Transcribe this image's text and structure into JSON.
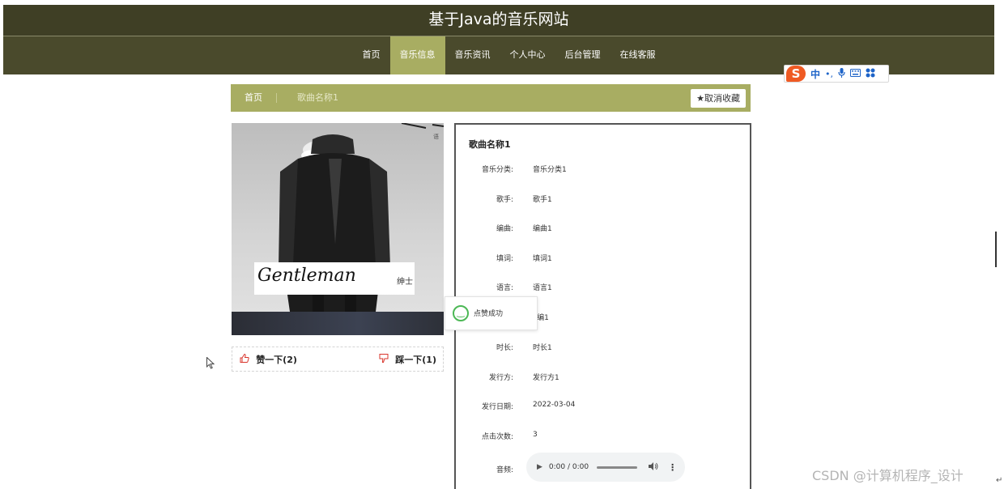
{
  "header": {
    "title": "基于Java的音乐网站",
    "nav": [
      {
        "label": "首页",
        "active": false
      },
      {
        "label": "音乐信息",
        "active": true
      },
      {
        "label": "音乐资讯",
        "active": false
      },
      {
        "label": "个人中心",
        "active": false
      },
      {
        "label": "后台管理",
        "active": false
      },
      {
        "label": "在线客服",
        "active": false
      }
    ],
    "bg_color": "#3f3f25",
    "accent_color": "#a8ad62"
  },
  "ime_toolbar": {
    "logo": "S",
    "mode": "中",
    "icons": [
      "punctuation-icon",
      "microphone-icon",
      "keyboard-icon",
      "grid-icon"
    ]
  },
  "breadcrumb": {
    "home": "首页",
    "current": "歌曲名称1",
    "unfavorite_label": "取消收藏"
  },
  "cover": {
    "signature_text": "Gentleman",
    "signature_label": "绅士"
  },
  "votes": {
    "like_label": "赞一下(2)",
    "dislike_label": "踩一下(1)"
  },
  "toast": {
    "message": "点赞成功"
  },
  "details": {
    "song_name": "歌曲名称1",
    "fields": [
      {
        "label": "音乐分类:",
        "value": "音乐分类1"
      },
      {
        "label": "歌手:",
        "value": "歌手1"
      },
      {
        "label": "编曲:",
        "value": "编曲1"
      },
      {
        "label": "填词:",
        "value": "填词1"
      },
      {
        "label": "语言:",
        "value": "语言1"
      },
      {
        "label": "",
        "value": "F编1"
      },
      {
        "label": "时长:",
        "value": "时长1"
      },
      {
        "label": "发行方:",
        "value": "发行方1"
      },
      {
        "label": "发行日期:",
        "value": "2022-03-04"
      },
      {
        "label": "点击次数:",
        "value": "3"
      }
    ],
    "audio_label": "音频:",
    "audio_time": "0:00 / 0:00"
  },
  "watermark": "CSDN @计算机程序_设计"
}
